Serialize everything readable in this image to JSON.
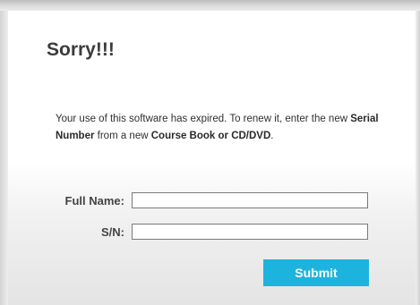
{
  "dialog": {
    "title": "Sorry!!!",
    "message": {
      "part1": "Your use of this software has expired. To renew it, enter the new ",
      "bold1": "Serial Number",
      "part2": " from a new ",
      "bold2": "Course Book or CD/DVD",
      "part3": "."
    }
  },
  "form": {
    "full_name_label": "Full Name:",
    "full_name_value": "",
    "sn_label": "S/N:",
    "sn_value": "",
    "submit_label": "Submit"
  },
  "colors": {
    "accent": "#1cb4df",
    "title_text": "#3b3b3b"
  }
}
